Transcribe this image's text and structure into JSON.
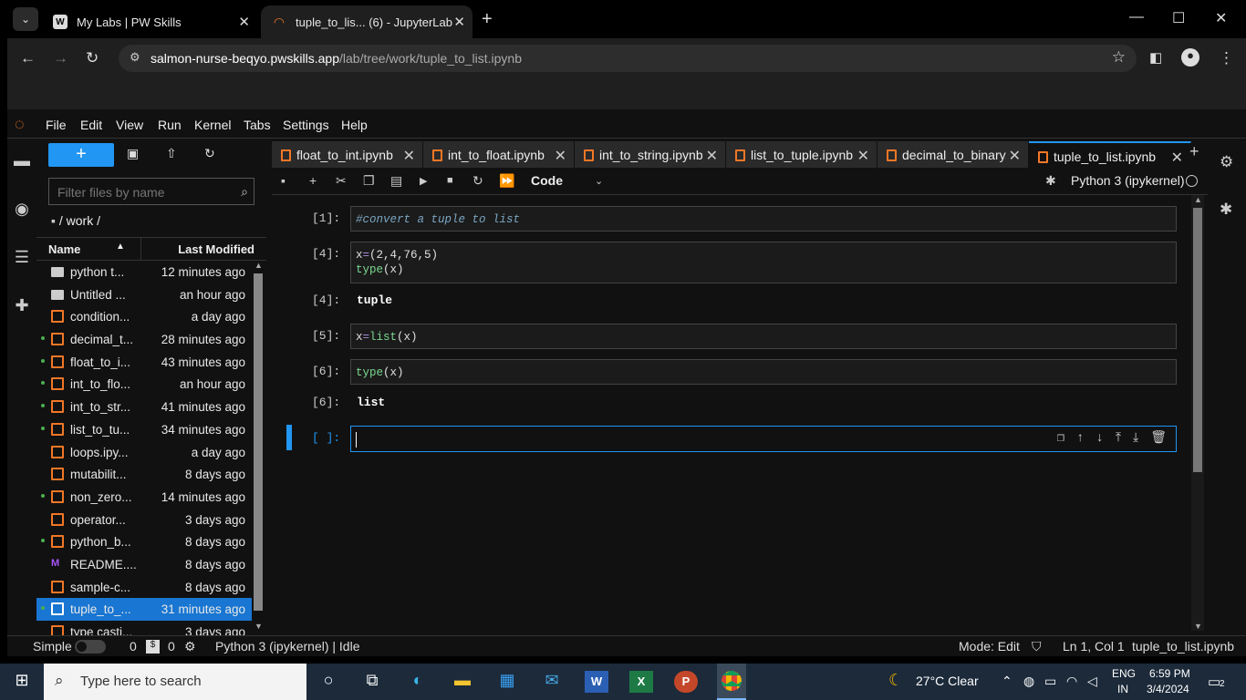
{
  "browser": {
    "tabs": [
      {
        "title": "My Labs | PW Skills"
      },
      {
        "title": "tuple_to_lis... (6) - JupyterLab"
      }
    ],
    "url_host": "salmon-nurse-beqyo.pwskills.app",
    "url_path": "/lab/tree/work/tuple_to_list.ipynb"
  },
  "menu": [
    "File",
    "Edit",
    "View",
    "Run",
    "Kernel",
    "Tabs",
    "Settings",
    "Help"
  ],
  "filebrowser": {
    "filter_placeholder": "Filter files by name",
    "breadcrumb": "/ work /",
    "col_name": "Name",
    "col_modified": "Last Modified",
    "files": [
      {
        "name": "python t...",
        "modified": "12 minutes ago",
        "type": "folder",
        "running": false
      },
      {
        "name": "Untitled ...",
        "modified": "an hour ago",
        "type": "folder",
        "running": false
      },
      {
        "name": "condition...",
        "modified": "a day ago",
        "type": "notebook",
        "running": false
      },
      {
        "name": "decimal_t...",
        "modified": "28 minutes ago",
        "type": "notebook",
        "running": true
      },
      {
        "name": "float_to_i...",
        "modified": "43 minutes ago",
        "type": "notebook",
        "running": true
      },
      {
        "name": "int_to_flo...",
        "modified": "an hour ago",
        "type": "notebook",
        "running": true
      },
      {
        "name": "int_to_str...",
        "modified": "41 minutes ago",
        "type": "notebook",
        "running": true
      },
      {
        "name": "list_to_tu...",
        "modified": "34 minutes ago",
        "type": "notebook",
        "running": true
      },
      {
        "name": "loops.ipy...",
        "modified": "a day ago",
        "type": "notebook",
        "running": false
      },
      {
        "name": "mutabilit...",
        "modified": "8 days ago",
        "type": "notebook",
        "running": false
      },
      {
        "name": "non_zero...",
        "modified": "14 minutes ago",
        "type": "notebook",
        "running": true
      },
      {
        "name": "operator...",
        "modified": "3 days ago",
        "type": "notebook",
        "running": false
      },
      {
        "name": "python_b...",
        "modified": "8 days ago",
        "type": "notebook",
        "running": true
      },
      {
        "name": "README....",
        "modified": "8 days ago",
        "type": "markdown",
        "running": false
      },
      {
        "name": "sample-c...",
        "modified": "8 days ago",
        "type": "notebook",
        "running": false
      },
      {
        "name": "tuple_to_...",
        "modified": "31 minutes ago",
        "type": "notebook",
        "running": true,
        "selected": true
      },
      {
        "name": "type casti...",
        "modified": "3 days ago",
        "type": "notebook",
        "running": false
      }
    ]
  },
  "notebook_tabs": [
    {
      "label": "float_to_int.ipynb",
      "active": false
    },
    {
      "label": "int_to_float.ipynb",
      "active": false
    },
    {
      "label": "int_to_string.ipynb",
      "active": false
    },
    {
      "label": "list_to_tuple.ipynb",
      "active": false
    },
    {
      "label": "decimal_to_binary.ip",
      "active": false
    },
    {
      "label": "tuple_to_list.ipynb",
      "active": true
    }
  ],
  "toolbar": {
    "cell_type": "Code",
    "kernel_name": "Python 3 (ipykernel)"
  },
  "cells": [
    {
      "prompt": "[1]:",
      "code": "#convert a tuple to list"
    },
    {
      "prompt": "[4]:",
      "code_line1_var": "x",
      "code_line1_rest": "(2,4,76,5)",
      "code_line2_fn": "type",
      "code_line2_rest": "(x)",
      "out_prompt": "[4]:",
      "output": "tuple"
    },
    {
      "prompt": "[5]:",
      "code_var": "x",
      "code_fn": "list",
      "code_rest": "(x)"
    },
    {
      "prompt": "[6]:",
      "code_fn": "type",
      "code_rest": "(x)",
      "out_prompt": "[6]:",
      "output": "list"
    },
    {
      "prompt": "[ ]:"
    }
  ],
  "statusbar": {
    "mode_simple": "Simple",
    "count_a": "0",
    "count_b": "0",
    "kernel_status": "Python 3 (ipykernel) | Idle",
    "mode": "Mode: Edit",
    "cursor": "Ln 1, Col 1",
    "filename": "tuple_to_list.ipynb"
  },
  "taskbar": {
    "search_placeholder": "Type here to search",
    "weather": "27°C  Clear",
    "lang1": "ENG",
    "lang2": "IN",
    "time": "6:59 PM",
    "date": "3/4/2024",
    "notif_count": "2"
  },
  "colors": {
    "accent": "#2196f3",
    "jupyter_orange": "#f37726",
    "running_green": "#4caf50"
  }
}
